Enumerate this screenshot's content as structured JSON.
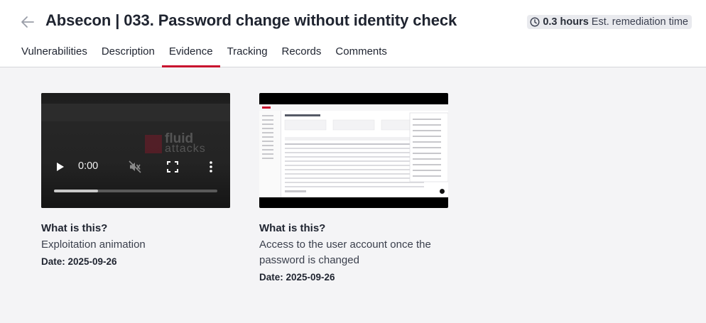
{
  "header": {
    "title": "Absecon | 033. Password change without identity check",
    "remediation_hours": "0.3 hours",
    "remediation_label": "Est. remediation time"
  },
  "tabs": [
    {
      "label": "Vulnerabilities"
    },
    {
      "label": "Description"
    },
    {
      "label": "Evidence",
      "active": true
    },
    {
      "label": "Tracking"
    },
    {
      "label": "Records"
    },
    {
      "label": "Comments"
    }
  ],
  "evidence": [
    {
      "media": "video",
      "time": "0:00",
      "progress": 0.27,
      "watermark": "fluid attacks",
      "title": "What is this?",
      "description": "Exploitation animation",
      "date": "Date: 2025-09-26"
    },
    {
      "media": "image",
      "title": "What is this?",
      "description": "Access to the user account once the password is changed",
      "date": "Date: 2025-09-26"
    }
  ],
  "colors": {
    "accent": "#c8102e",
    "page_background": "#f4f4f6",
    "text": "#1f2430"
  }
}
